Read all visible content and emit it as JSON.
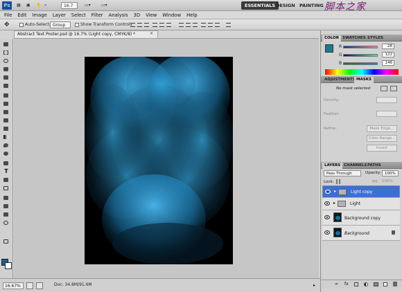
{
  "app": {
    "logo": "Ps",
    "zoom_control": "16.7",
    "workspaces": [
      "ESSENTIALS",
      "DESIGN",
      "PAINTING"
    ],
    "watermark": "脚本之家"
  },
  "menu": [
    "File",
    "Edit",
    "Image",
    "Layer",
    "Select",
    "Filter",
    "Analysis",
    "3D",
    "View",
    "Window",
    "Help"
  ],
  "options_bar": {
    "auto_select_label": "Auto-Select:",
    "auto_select_value": "Group",
    "show_transform_label": "Show Transform Controls"
  },
  "document": {
    "tab_title": "Abstract Text Poster.psd @ 16.7% (Light copy, CMYK/8) *",
    "close_glyph": "×"
  },
  "status": {
    "zoom": "16.67%",
    "doc_info": "Doc: 34.8M/91.6M"
  },
  "color_panel": {
    "tabs": [
      "COLOR",
      "SWATCHES",
      "STYLES"
    ],
    "labels": [
      "R",
      "G",
      "B"
    ],
    "values": [
      "28",
      "122",
      "146"
    ],
    "swatch": "#1c7a92"
  },
  "adjust_panel": {
    "tabs": [
      "ADJUSTMENTS",
      "MASKS"
    ],
    "status": "No mask selected",
    "field_labels": [
      "Density:",
      "Feather:"
    ],
    "refine_label": "Refine:",
    "buttons": [
      "Mask Edge...",
      "Color Range...",
      "Invert"
    ]
  },
  "layers_panel": {
    "tabs": [
      "LAYERS",
      "CHANNELS",
      "PATHS"
    ],
    "blend_mode": "Pass Through",
    "opacity_label": "Opacity:",
    "opacity_value": "100%",
    "lock_label": "Lock:",
    "fill_label": "Fill:",
    "fill_value": "100%",
    "layers": [
      {
        "name": "Light copy",
        "type": "group",
        "selected": true
      },
      {
        "name": "Light",
        "type": "group",
        "selected": false
      },
      {
        "name": "Background copy",
        "type": "pixel",
        "selected": false
      },
      {
        "name": "Background",
        "type": "pixel",
        "selected": false
      }
    ]
  },
  "colors": {
    "accent": "#3d6fd1",
    "canvas_blue": "#1d8ac4"
  }
}
